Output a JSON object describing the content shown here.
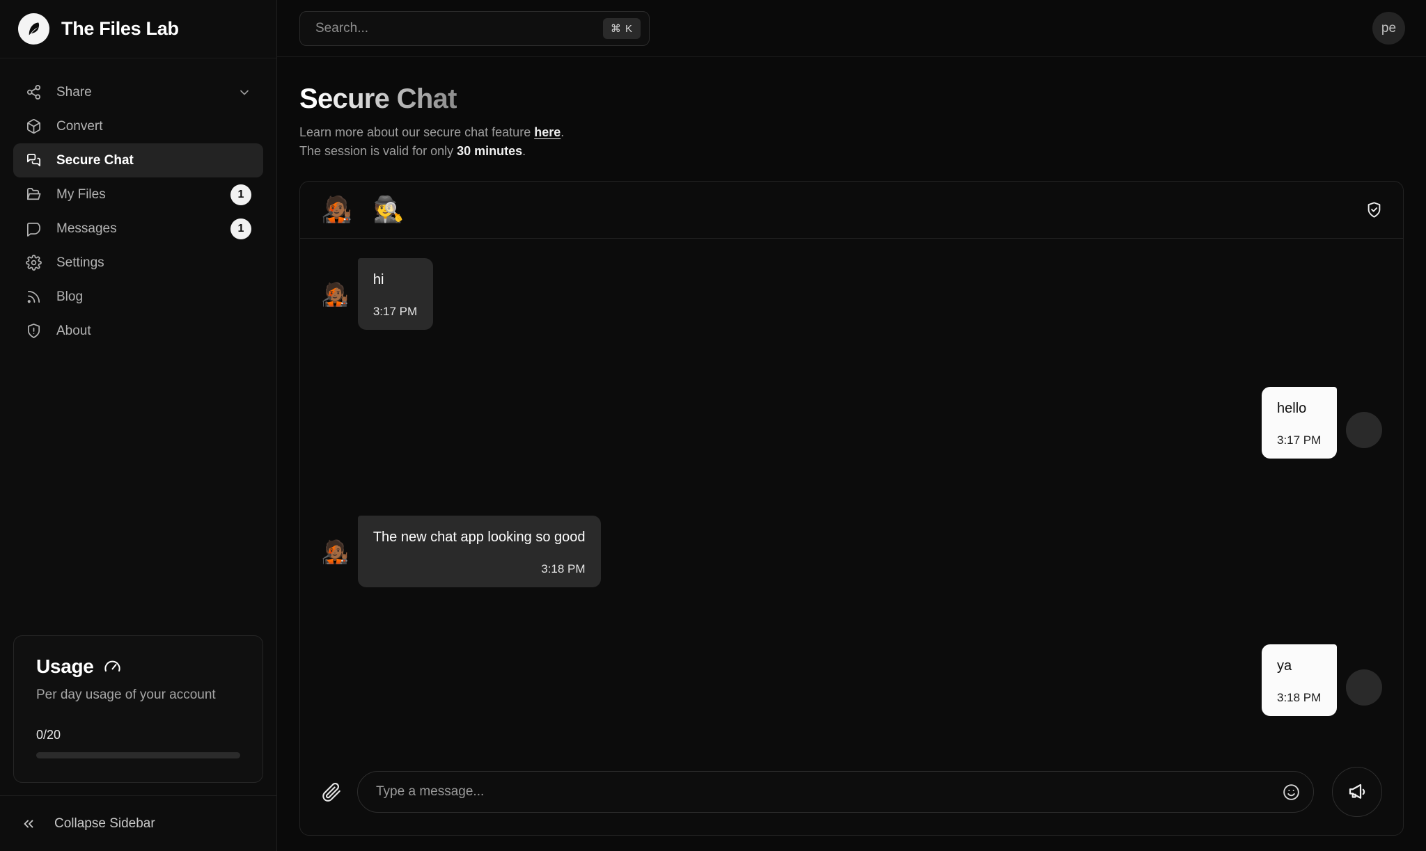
{
  "brand": {
    "name": "The Files Lab",
    "logo_icon": "feather-logo-icon"
  },
  "sidebar": {
    "items": [
      {
        "label": "Share",
        "icon": "share-nodes-icon",
        "badge": null,
        "chevron": true,
        "active": false
      },
      {
        "label": "Convert",
        "icon": "box-3d-icon",
        "badge": null,
        "chevron": false,
        "active": false
      },
      {
        "label": "Secure Chat",
        "icon": "chat-bubbles-icon",
        "badge": null,
        "chevron": false,
        "active": true
      },
      {
        "label": "My Files",
        "icon": "folder-open-icon",
        "badge": "1",
        "chevron": false,
        "active": false
      },
      {
        "label": "Messages",
        "icon": "message-bubble-icon",
        "badge": "1",
        "chevron": false,
        "active": false
      },
      {
        "label": "Settings",
        "icon": "gear-icon",
        "badge": null,
        "chevron": false,
        "active": false
      },
      {
        "label": "Blog",
        "icon": "rss-icon",
        "badge": null,
        "chevron": false,
        "active": false
      },
      {
        "label": "About",
        "icon": "shield-alert-icon",
        "badge": null,
        "chevron": false,
        "active": false
      }
    ],
    "usage": {
      "title": "Usage",
      "icon": "gauge-icon",
      "subtitle": "Per day usage of your account",
      "count": "0/20",
      "percent": 0
    },
    "collapse": {
      "label": "Collapse Sidebar",
      "icon": "chevrons-left-icon"
    }
  },
  "topbar": {
    "search": {
      "placeholder": "Search...",
      "value": "",
      "shortcut": "⌘ K",
      "icon": "search-icon"
    },
    "avatar": {
      "initials": "pe"
    }
  },
  "page": {
    "title": "Secure Chat",
    "subtitle_prefix": "Learn more about our secure chat feature ",
    "subtitle_link": "here",
    "subtitle_suffix": ".",
    "session_prefix": "The session is valid for only ",
    "session_strong": "30 minutes",
    "session_suffix": "."
  },
  "chat": {
    "header": {
      "participants": [
        {
          "avatar": "🧑🏾‍🎤",
          "name": "green-hair-avatar"
        },
        {
          "avatar": "🕵️",
          "name": "incognito-avatar"
        }
      ],
      "secure_icon": "shield-check-icon"
    },
    "messages": [
      {
        "direction": "in",
        "text": "hi",
        "time": "3:17 PM",
        "avatar": "🧑🏾‍🎤"
      },
      {
        "direction": "out",
        "text": "hello",
        "time": "3:17 PM",
        "avatar": ""
      },
      {
        "direction": "in",
        "text": "The new chat app looking so good",
        "time": "3:18 PM",
        "avatar": "🧑🏾‍🎤"
      },
      {
        "direction": "out",
        "text": "ya",
        "time": "3:18 PM",
        "avatar": ""
      }
    ],
    "composer": {
      "attach_icon": "paperclip-icon",
      "placeholder": "Type a message...",
      "value": "",
      "emoji_icon": "smiley-icon",
      "send_icon": "megaphone-send-icon"
    }
  },
  "colors": {
    "background": "#0a0a0a",
    "sidebar": "#0d0d0d",
    "border": "#232323",
    "bubble_in": "#2a2a2a",
    "bubble_out": "#fbfbfb",
    "accent": "#ffffff"
  }
}
